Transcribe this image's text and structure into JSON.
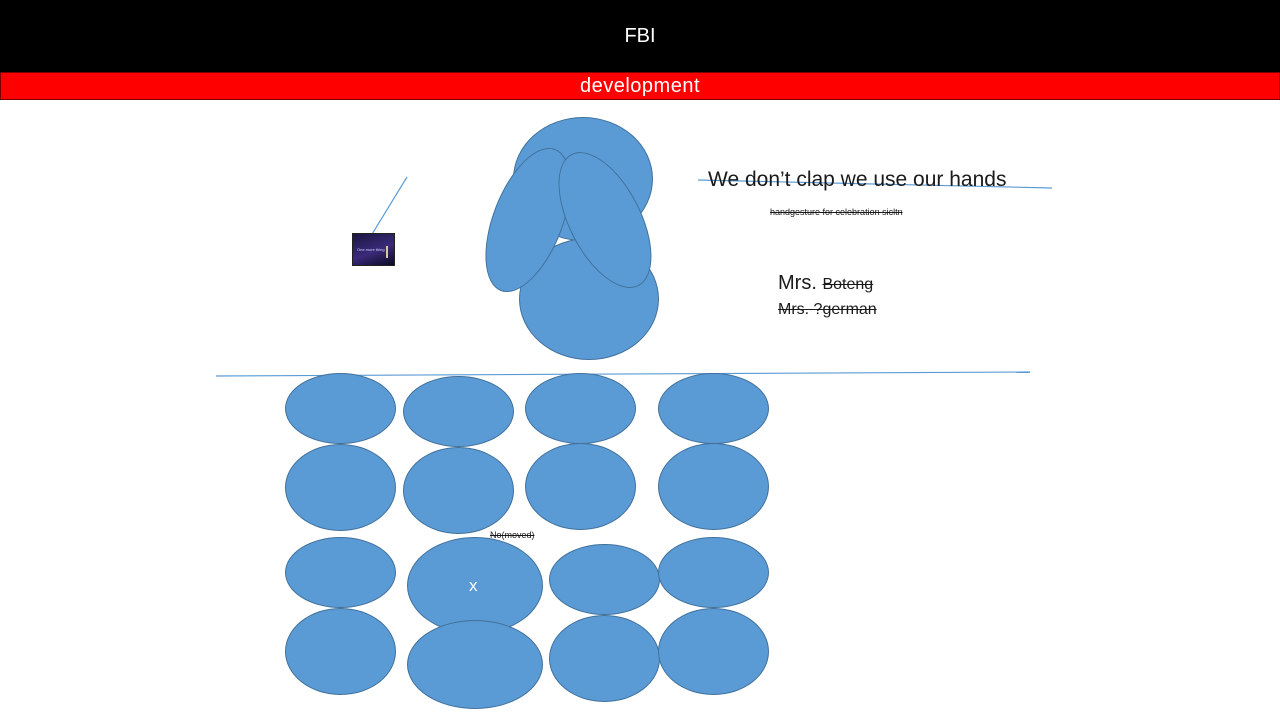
{
  "header": {
    "title": "FBI"
  },
  "banner": {
    "label": "development"
  },
  "thumbnail": {
    "caption": "One more thing"
  },
  "notes": {
    "headline": "We don’t clap we use our hands",
    "subnote": "handgesture for celebration sicltn",
    "name_prefix": "Mrs.",
    "name_struck": "Boteng",
    "name_alt": "Mrs. ?german",
    "seat_note": "No(moved)",
    "seat_mark": "x"
  },
  "colors": {
    "shape_fill": "#5b9bd5",
    "shape_border": "#41719c",
    "banner": "#ff0000",
    "header": "#000000"
  }
}
